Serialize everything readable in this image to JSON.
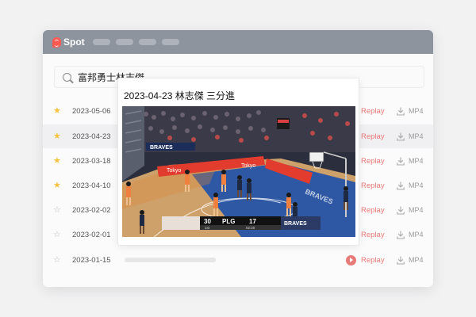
{
  "app": {
    "name": "Spot"
  },
  "search": {
    "value": "富邦勇士林志傑"
  },
  "rows": [
    {
      "date": "2023-05-06",
      "starred": true
    },
    {
      "date": "2023-04-23",
      "starred": true
    },
    {
      "date": "2023-03-18",
      "starred": true
    },
    {
      "date": "2023-04-10",
      "starred": true
    },
    {
      "date": "2023-02-02",
      "starred": false
    },
    {
      "date": "2023-02-01",
      "starred": false
    },
    {
      "date": "2023-01-15",
      "starred": false
    }
  ],
  "actions": {
    "replay_label": "Replay",
    "mp4_label": "MP4"
  },
  "popup": {
    "title": "2023-04-23 林志傑 三分進",
    "scoreboard": {
      "home_score": "30",
      "league": "PLG",
      "away_score": "17",
      "away_team": "BRAVES",
      "quarter": "1st",
      "clock": "02:20"
    },
    "banners": {
      "sponsor": "Tokyo",
      "team": "BRAVES"
    }
  },
  "colors": {
    "accent": "#e87a78",
    "titlebar": "#8e949d",
    "star": "#f6c23e",
    "brand": "#ff5a52"
  }
}
